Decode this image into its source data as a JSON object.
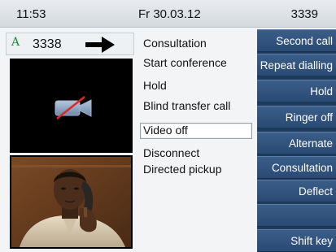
{
  "status_bar": {
    "time": "11:53",
    "date": "Fr 30.03.12",
    "own_number": "3339"
  },
  "call": {
    "line_indicator": "A",
    "number": "3338"
  },
  "menu": {
    "items": [
      "Consultation",
      "Start conference",
      "Hold",
      "Blind transfer call",
      "Video off",
      "Disconnect",
      "Directed pickup"
    ],
    "selected_index": 4
  },
  "softkeys": [
    "Second call",
    "Repeat dialling",
    "Hold",
    "Ringer off",
    "Alternate",
    "Consultation",
    "Deflect",
    "",
    "Shift key"
  ],
  "colors": {
    "softkey_bg": "#2e4f78",
    "line_indicator": "#1b8a3d",
    "video_off_slash": "#e0261f"
  },
  "icons": {
    "direction_arrow": "arrow-right-icon",
    "video_off": "video-camera-off-icon"
  }
}
